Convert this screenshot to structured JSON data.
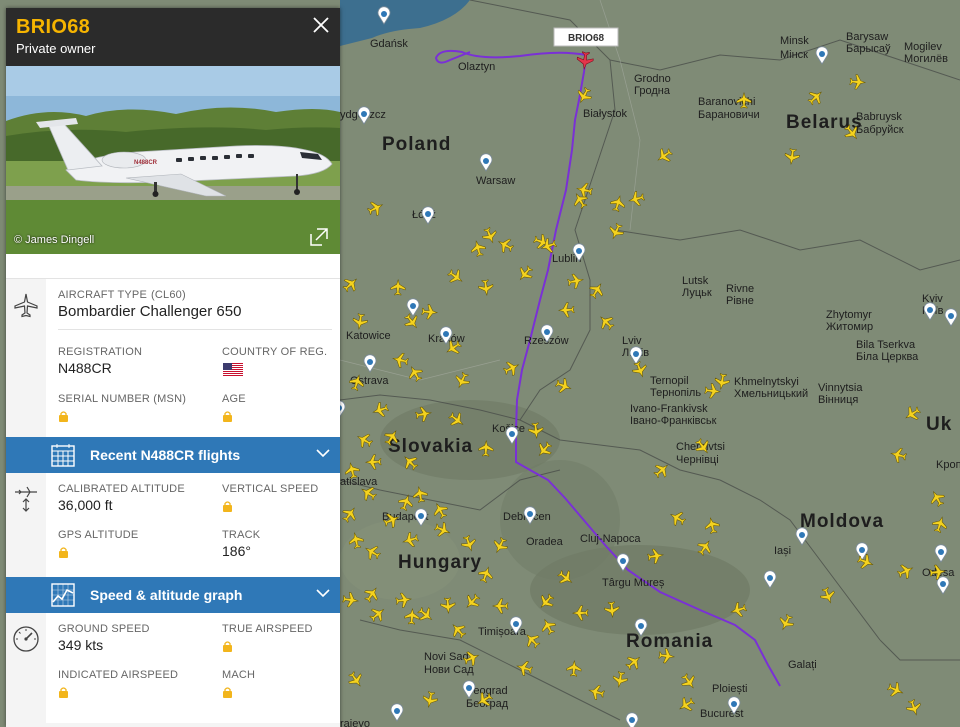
{
  "flight": {
    "callsign": "BRIO68",
    "owner": "Private owner",
    "photo_credit": "© James Dingell"
  },
  "aircraft": {
    "type_label": "AIRCRAFT TYPE",
    "type_code": "(CL60)",
    "type_value": "Bombardier Challenger 650",
    "registration_label": "REGISTRATION",
    "registration_value": "N488CR",
    "country_label": "COUNTRY OF REG.",
    "msn_label": "SERIAL NUMBER (MSN)",
    "age_label": "AGE"
  },
  "recent_flights_label": "Recent N488CR flights",
  "altitude": {
    "calibrated_label": "CALIBRATED ALTITUDE",
    "calibrated_value": "36,000 ft",
    "vs_label": "VERTICAL SPEED",
    "gps_label": "GPS ALTITUDE",
    "track_label": "TRACK",
    "track_value": "186°"
  },
  "speed_graph_label": "Speed & altitude graph",
  "speed": {
    "ground_label": "GROUND SPEED",
    "ground_value": "349 kts",
    "true_label": "TRUE AIRSPEED",
    "indicated_label": "INDICATED AIRSPEED",
    "mach_label": "MACH"
  },
  "map": {
    "flight_tag": "BRIO68",
    "countries": [
      "Poland",
      "Belarus",
      "Slovakia",
      "Hungary",
      "Romania",
      "Moldova",
      "Uk"
    ],
    "cities": [
      {
        "name": "Gdańsk"
      },
      {
        "name": "Olaztyn"
      },
      {
        "name": "ydgoszcz"
      },
      {
        "name": "Białystok"
      },
      {
        "name": "Grodno"
      },
      {
        "name": "Гродна"
      },
      {
        "name": "Minsk"
      },
      {
        "name": "Мінск"
      },
      {
        "name": "Barysaw"
      },
      {
        "name": "Барысаў"
      },
      {
        "name": "Mogilev"
      },
      {
        "name": "Могилёв"
      },
      {
        "name": "Baranovichi"
      },
      {
        "name": "Барановичи"
      },
      {
        "name": "Babruysk"
      },
      {
        "name": "Бабруйск"
      },
      {
        "name": "Warsaw"
      },
      {
        "name": "Łódź"
      },
      {
        "name": "Lublin"
      },
      {
        "name": "Lutsk"
      },
      {
        "name": "Луцьк"
      },
      {
        "name": "Rivne"
      },
      {
        "name": "Рівне"
      },
      {
        "name": "Zhytomyr"
      },
      {
        "name": "Житомир"
      },
      {
        "name": "Kyiv"
      },
      {
        "name": "Київ"
      },
      {
        "name": "Katowice"
      },
      {
        "name": "Kraków"
      },
      {
        "name": "Rzeszów"
      },
      {
        "name": "Lviv"
      },
      {
        "name": "Львів"
      },
      {
        "name": "Bila Tserkva"
      },
      {
        "name": "Біла Церква"
      },
      {
        "name": "Ostrava"
      },
      {
        "name": "Ternopil"
      },
      {
        "name": "Тернопіль"
      },
      {
        "name": "Khmelnytskyi"
      },
      {
        "name": "Хмельницький"
      },
      {
        "name": "Vinnytsia"
      },
      {
        "name": "Вінниця"
      },
      {
        "name": "Ivano-Frankivsk"
      },
      {
        "name": "Івано-Франківськ"
      },
      {
        "name": "Košice"
      },
      {
        "name": "Chernivtsi"
      },
      {
        "name": "Чернівці"
      },
      {
        "name": "Kропи"
      },
      {
        "name": "atislava"
      },
      {
        "name": "Budapest"
      },
      {
        "name": "Debrecen"
      },
      {
        "name": "Oradea"
      },
      {
        "name": "Cluj-Napoca"
      },
      {
        "name": "Târgu Mureș"
      },
      {
        "name": "Iași"
      },
      {
        "name": "Odesa"
      },
      {
        "name": "Timișoara"
      },
      {
        "name": "Novi Sad"
      },
      {
        "name": "Нови Сад"
      },
      {
        "name": "Beograd"
      },
      {
        "name": "Београд"
      },
      {
        "name": "Galați"
      },
      {
        "name": "Ploiești"
      },
      {
        "name": "Bucurest"
      },
      {
        "name": "rajevo"
      }
    ]
  }
}
